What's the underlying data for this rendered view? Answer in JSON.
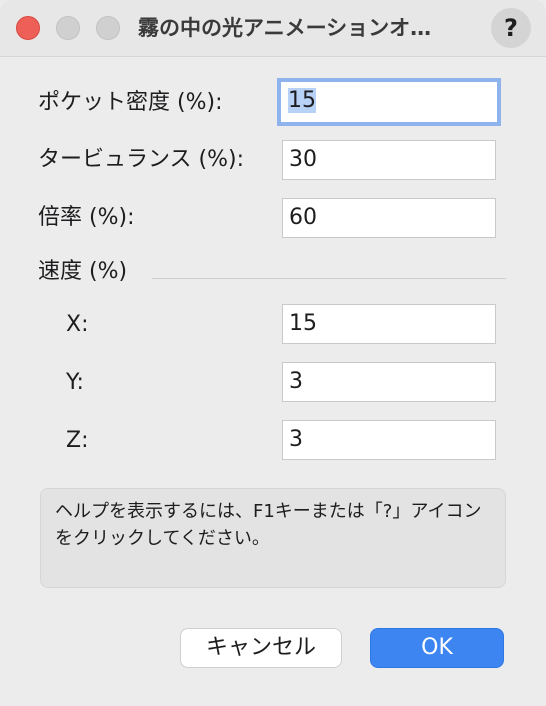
{
  "window": {
    "title": "霧の中の光アニメーションオ…",
    "help_button_label": "?"
  },
  "form": {
    "pocket_density_label": "ポケット密度 (%):",
    "pocket_density_value": "15",
    "turbulence_label": "タービュランス (%):",
    "turbulence_value": "30",
    "scale_label": "倍率 (%):",
    "scale_value": "60",
    "speed_section_label": "速度 (%)",
    "speed_x_label": "X:",
    "speed_x_value": "15",
    "speed_y_label": "Y:",
    "speed_y_value": "3",
    "speed_z_label": "Z:",
    "speed_z_value": "3"
  },
  "help_text": "ヘルプを表示するには、F1キーまたは「?」アイコンをクリックしてください。",
  "buttons": {
    "cancel_label": "キャンセル",
    "ok_label": "OK"
  },
  "colors": {
    "ok_button": "#3d85f1",
    "close_light": "#ee5f57",
    "focus_ring": "#8fb3ec",
    "selection": "#b7d1f7"
  }
}
